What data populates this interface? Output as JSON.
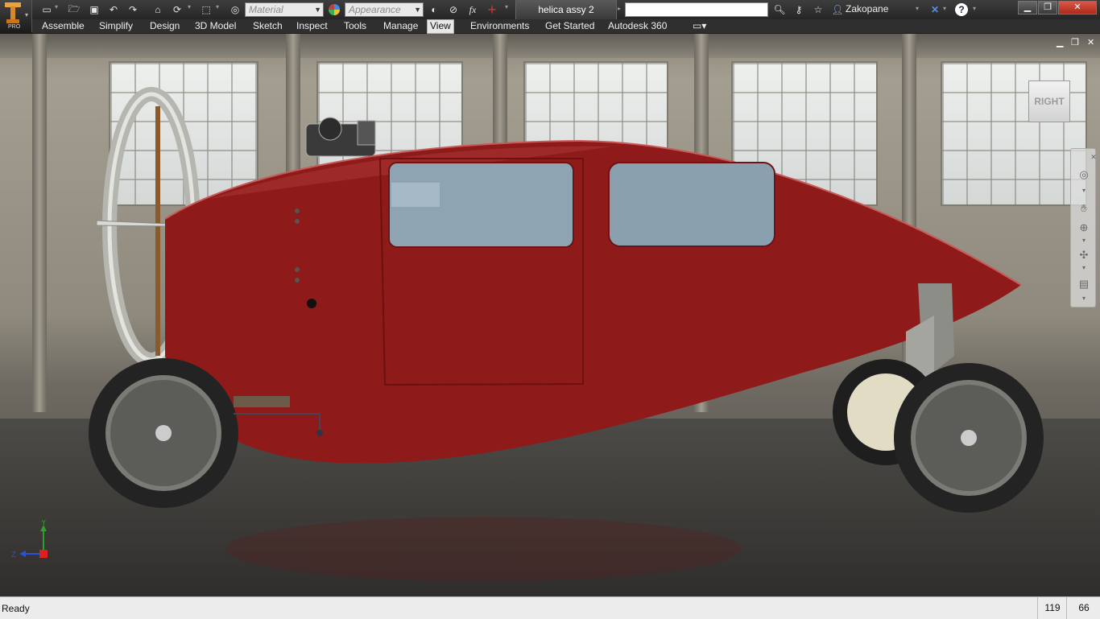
{
  "app": {
    "badge": "PRO",
    "document_title": "helica assy 2"
  },
  "quick_access": {
    "material_placeholder": "Material",
    "appearance_placeholder": "Appearance",
    "function_symbol": "fx"
  },
  "help": {
    "user_name": "Zakopane",
    "help_label": "?"
  },
  "ribbon_tabs": [
    "Assemble",
    "Simplify",
    "Design",
    "3D Model",
    "Sketch",
    "Inspect",
    "Tools",
    "Manage",
    "View",
    "Environments",
    "Get Started",
    "Autodesk 360"
  ],
  "active_tab": "View",
  "viewcube": {
    "face_label": "RIGHT"
  },
  "triad": {
    "y_label": "Y",
    "z_label": "Z"
  },
  "status": {
    "text": "Ready",
    "count_a": "119",
    "count_b": "66"
  },
  "colors": {
    "body_red": "#8e1a1a",
    "ribbon_dark": "#2f2f2f",
    "active_tab_bg": "#e8e8e8"
  },
  "icons": [
    "new-icon",
    "open-icon",
    "save-icon",
    "undo-icon",
    "redo-icon",
    "home-icon",
    "update-icon",
    "select-icon",
    "appearance-icon",
    "adjust-icon",
    "clear-icon",
    "function-icon",
    "measure-icon",
    "binoculars-icon",
    "key-icon",
    "star-icon",
    "user-icon",
    "exchange-icon",
    "help-icon",
    "steering-wheel-icon",
    "pan-icon",
    "zoom-icon",
    "orbit-icon",
    "look-at-icon"
  ]
}
